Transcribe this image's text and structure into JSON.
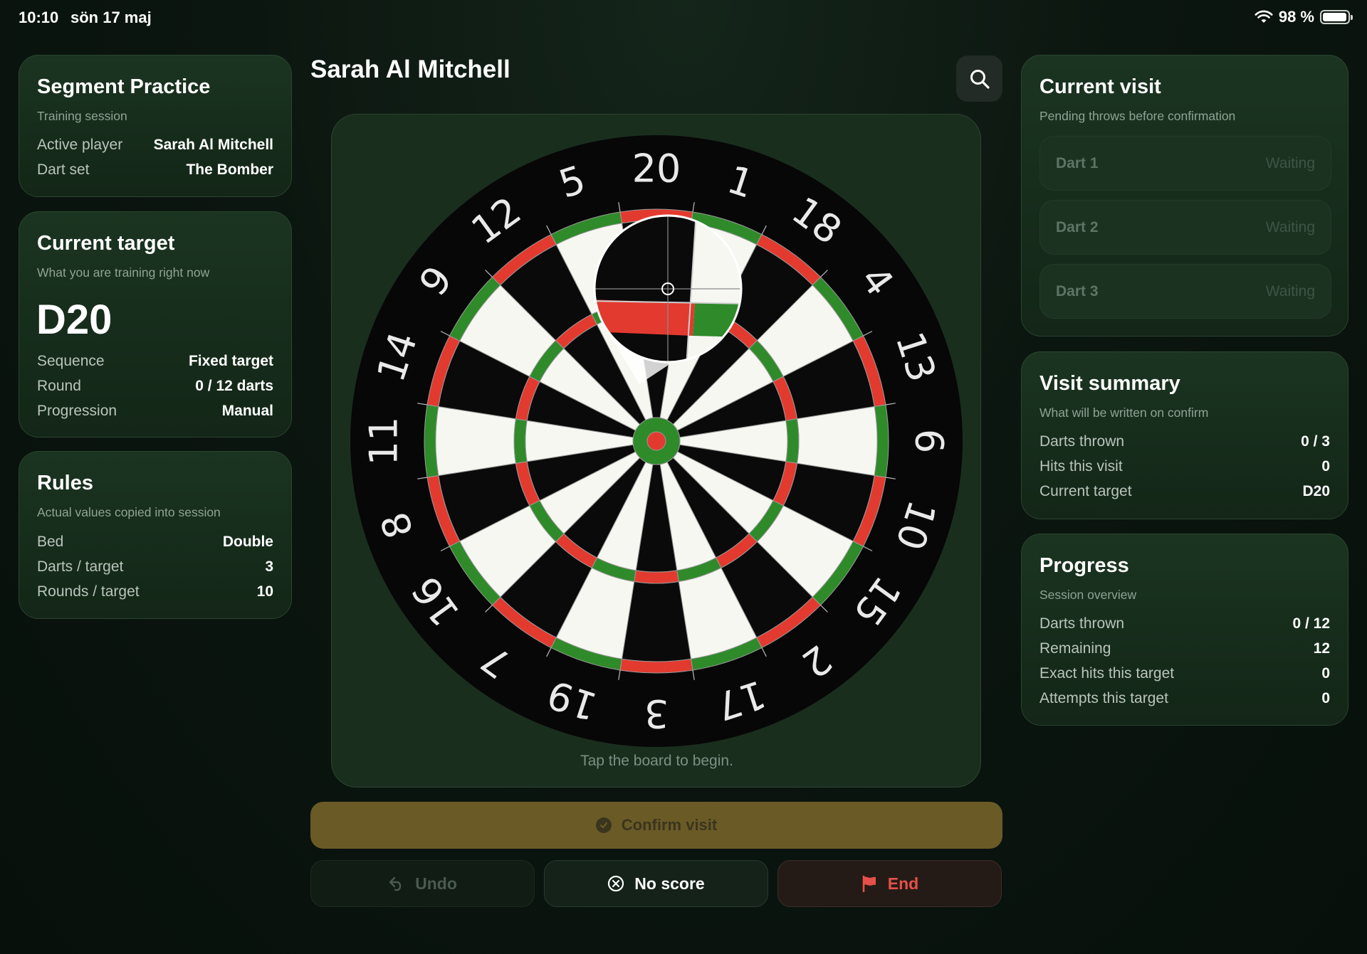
{
  "status_bar": {
    "time": "10:10",
    "date": "sön 17 maj",
    "battery": "98 %",
    "battery_level": 0.98
  },
  "header": {
    "player_name": "Sarah Al Mitchell"
  },
  "segment_practice": {
    "title": "Segment Practice",
    "subtitle": "Training session",
    "rows": [
      {
        "label": "Active player",
        "value": "Sarah Al Mitchell"
      },
      {
        "label": "Dart set",
        "value": "The Bomber"
      }
    ]
  },
  "current_target": {
    "title": "Current target",
    "subtitle": "What you are training right now",
    "target": "D20",
    "rows": [
      {
        "label": "Sequence",
        "value": "Fixed target"
      },
      {
        "label": "Round",
        "value": "0 / 12 darts"
      },
      {
        "label": "Progression",
        "value": "Manual"
      }
    ]
  },
  "rules": {
    "title": "Rules",
    "subtitle": "Actual values copied into session",
    "rows": [
      {
        "label": "Bed",
        "value": "Double"
      },
      {
        "label": "Darts / target",
        "value": "3"
      },
      {
        "label": "Rounds / target",
        "value": "10"
      }
    ]
  },
  "board": {
    "numbers": [
      "20",
      "1",
      "18",
      "4",
      "13",
      "6",
      "10",
      "15",
      "2",
      "17",
      "3",
      "19",
      "7",
      "16",
      "8",
      "11",
      "14",
      "9",
      "12",
      "5"
    ],
    "hint": "Tap the board to begin.",
    "colors": {
      "red": "#e33a2f",
      "green": "#2f8a2a",
      "black": "#0a0a0a",
      "white": "#f7f7f2"
    }
  },
  "current_visit": {
    "title": "Current visit",
    "subtitle": "Pending throws before confirmation",
    "darts": [
      {
        "label": "Dart 1",
        "status": "Waiting"
      },
      {
        "label": "Dart 2",
        "status": "Waiting"
      },
      {
        "label": "Dart 3",
        "status": "Waiting"
      }
    ]
  },
  "visit_summary": {
    "title": "Visit summary",
    "subtitle": "What will be written on confirm",
    "rows": [
      {
        "label": "Darts thrown",
        "value": "0 / 3"
      },
      {
        "label": "Hits this visit",
        "value": "0"
      },
      {
        "label": "Current target",
        "value": "D20"
      }
    ]
  },
  "progress": {
    "title": "Progress",
    "subtitle": "Session overview",
    "rows": [
      {
        "label": "Darts thrown",
        "value": "0 / 12"
      },
      {
        "label": "Remaining",
        "value": "12"
      },
      {
        "label": "Exact hits this target",
        "value": "0"
      },
      {
        "label": "Attempts this target",
        "value": "0"
      }
    ]
  },
  "actions": {
    "confirm_label": "Confirm visit",
    "undo_label": "Undo",
    "no_score_label": "No score",
    "end_label": "End"
  }
}
